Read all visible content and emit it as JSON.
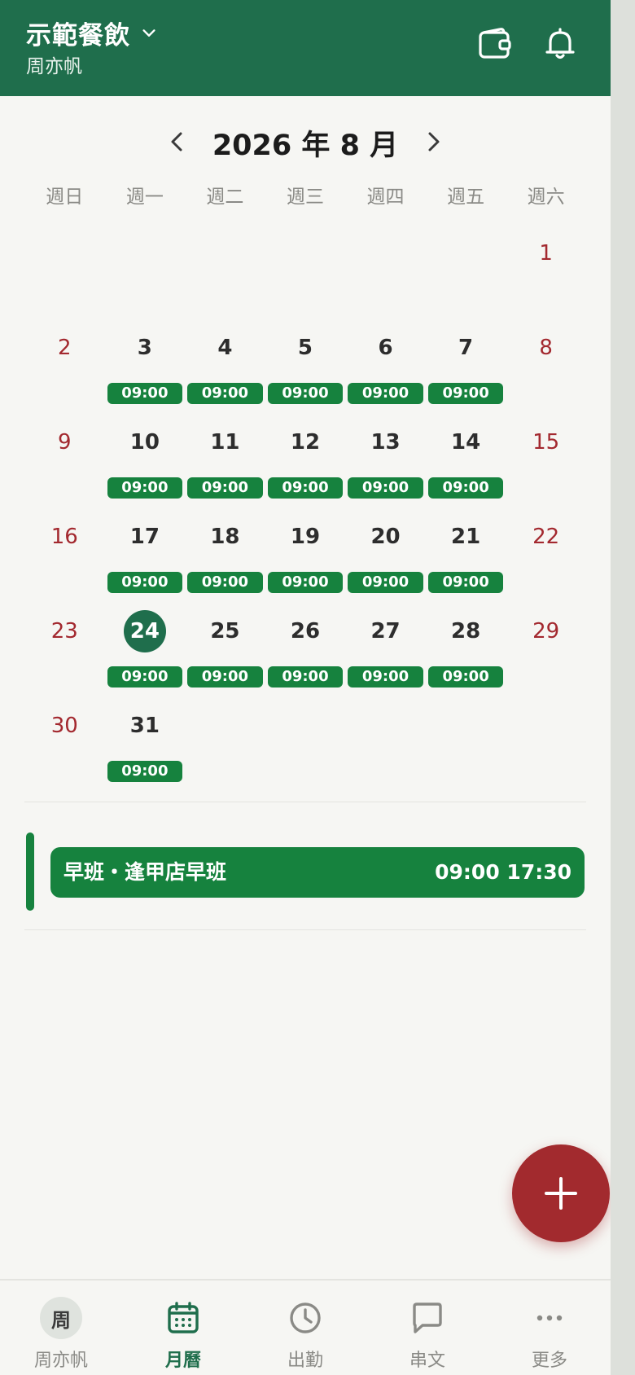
{
  "header": {
    "org_name": "示範餐飲",
    "user_name": "周亦帆",
    "icons": [
      "chevron-down-icon",
      "wallet-icon",
      "bell-icon"
    ]
  },
  "calendar": {
    "title": "2026 年 8 月",
    "weekdays": [
      "週日",
      "週一",
      "週二",
      "週三",
      "週四",
      "週五",
      "週六"
    ],
    "weeks": [
      [
        {
          "day": ""
        },
        {
          "day": ""
        },
        {
          "day": ""
        },
        {
          "day": ""
        },
        {
          "day": ""
        },
        {
          "day": ""
        },
        {
          "day": "1"
        }
      ],
      [
        {
          "day": "2"
        },
        {
          "day": "3",
          "shift": "09:00"
        },
        {
          "day": "4",
          "shift": "09:00"
        },
        {
          "day": "5",
          "shift": "09:00"
        },
        {
          "day": "6",
          "shift": "09:00"
        },
        {
          "day": "7",
          "shift": "09:00"
        },
        {
          "day": "8"
        }
      ],
      [
        {
          "day": "9"
        },
        {
          "day": "10",
          "shift": "09:00"
        },
        {
          "day": "11",
          "shift": "09:00"
        },
        {
          "day": "12",
          "shift": "09:00"
        },
        {
          "day": "13",
          "shift": "09:00"
        },
        {
          "day": "14",
          "shift": "09:00"
        },
        {
          "day": "15"
        }
      ],
      [
        {
          "day": "16"
        },
        {
          "day": "17",
          "shift": "09:00"
        },
        {
          "day": "18",
          "shift": "09:00"
        },
        {
          "day": "19",
          "shift": "09:00"
        },
        {
          "day": "20",
          "shift": "09:00"
        },
        {
          "day": "21",
          "shift": "09:00"
        },
        {
          "day": "22"
        }
      ],
      [
        {
          "day": "23"
        },
        {
          "day": "24",
          "shift": "09:00",
          "today": true
        },
        {
          "day": "25",
          "shift": "09:00"
        },
        {
          "day": "26",
          "shift": "09:00"
        },
        {
          "day": "27",
          "shift": "09:00"
        },
        {
          "day": "28",
          "shift": "09:00"
        },
        {
          "day": "29"
        }
      ],
      [
        {
          "day": "30"
        },
        {
          "day": "31",
          "shift": "09:00"
        },
        {
          "day": ""
        },
        {
          "day": ""
        },
        {
          "day": ""
        },
        {
          "day": ""
        },
        {
          "day": ""
        }
      ]
    ]
  },
  "selected_shift": {
    "name": "早班・逢甲店早班",
    "time": "09:00 17:30"
  },
  "colors": {
    "header": "#1f6e4c",
    "shift_chip": "#16823e",
    "weekend_text": "#a3292f",
    "fab": "#a22a2e"
  },
  "bottom_nav": {
    "tabs": [
      {
        "label": "周亦帆",
        "icon": "avatar",
        "avatar_text": "周"
      },
      {
        "label": "月曆",
        "icon": "calendar-icon",
        "active": true
      },
      {
        "label": "出勤",
        "icon": "clock-icon"
      },
      {
        "label": "串文",
        "icon": "chat-icon"
      },
      {
        "label": "更多",
        "icon": "more-icon"
      }
    ]
  }
}
